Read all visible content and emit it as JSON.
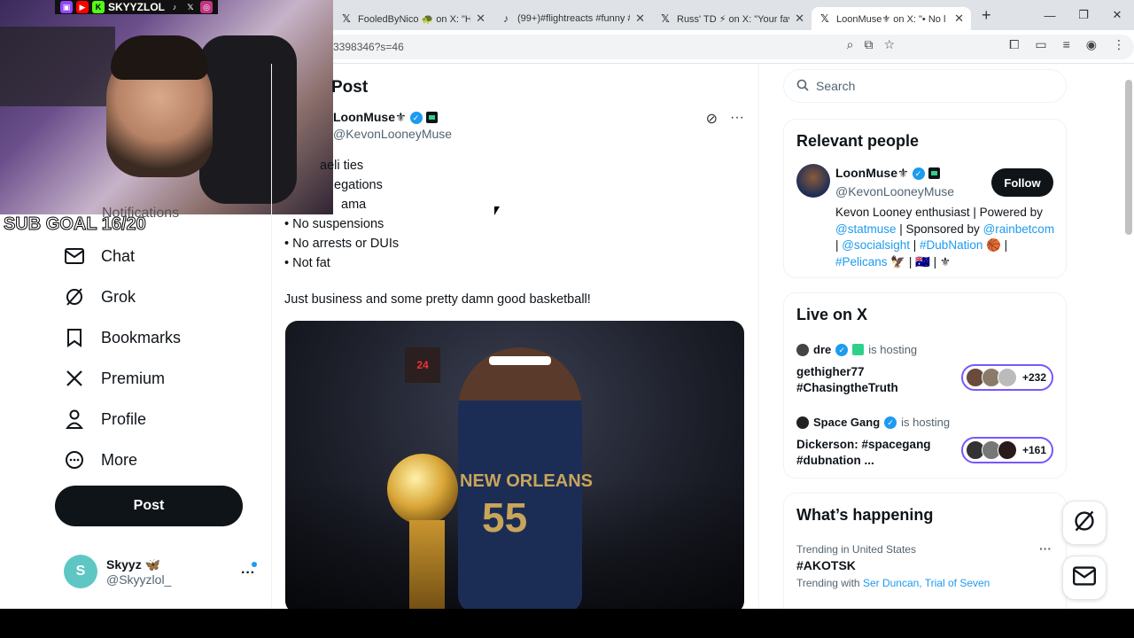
{
  "browser": {
    "tabs": [
      {
        "title": "FooledByNico 🐢 on X: \"He",
        "icon": "x-icon",
        "active": false
      },
      {
        "title": "(99+)#flightreacts #funny #",
        "icon": "tiktok-icon",
        "active": false
      },
      {
        "title": "Russ' TD ⚡ on X: \"Your fav",
        "icon": "x-icon",
        "active": false
      },
      {
        "title": "LoonMuse⚜ on X: \"• No l",
        "icon": "x-icon",
        "active": true
      }
    ],
    "url": "3398346?s=46"
  },
  "stream": {
    "username": "SKYYZLOL",
    "sub_goal": "SUB GOAL 16/20",
    "colors": {
      "twitch": "#9146ff",
      "youtube": "#ff0000",
      "kick": "#53fc18"
    }
  },
  "nav": {
    "partial_label": "Notifications",
    "items": [
      {
        "label": "Chat",
        "icon": "mail-icon"
      },
      {
        "label": "Grok",
        "icon": "grok-icon"
      },
      {
        "label": "Bookmarks",
        "icon": "bookmark-icon"
      },
      {
        "label": "Premium",
        "icon": "x-logo-icon"
      },
      {
        "label": "Profile",
        "icon": "person-icon"
      },
      {
        "label": "More",
        "icon": "more-circle-icon"
      }
    ],
    "post_label": "Post",
    "account": {
      "name": "Skyyz 🦋",
      "handle": "@Skyyzlol_"
    }
  },
  "post": {
    "header": "Post",
    "author_name": "LoonMuse⚜",
    "author_handle": "@KevonLooneyMuse",
    "lines": [
      "• Israeli ties",
      "• Allegations",
      "• Drama",
      "• No suspensions",
      "• No arrests or DUIs",
      "• Not fat"
    ],
    "visible_lines": [
      "aeli ties",
      "egations",
      "ama",
      "• No suspensions",
      "• No arrests or DUIs",
      "• Not fat"
    ],
    "body": "Just business and some pretty damn good basketball!",
    "image": {
      "jersey": "NEW ORLEANS",
      "number": "55",
      "scoreboard": "24"
    }
  },
  "sidebar": {
    "search_placeholder": "Search",
    "relevant": {
      "title": "Relevant people",
      "name": "LoonMuse⚜",
      "handle": "@KevonLooneyMuse",
      "follow": "Follow",
      "bio_1": "Kevon Looney enthusiast | Powered by",
      "bio_link_1": "@statmuse",
      "bio_2": " | Sponsored by",
      "bio_link_2": "@rainbetcom",
      "bio_sep": " | ",
      "bio_link_3": "@socialsight",
      "bio_sep2": " |",
      "bio_link_4": "#DubNation",
      "bio_mid": " 🏀 | ",
      "bio_link_5": "#Pelicans",
      "bio_tail": " 🦅 | 🇦🇺 | ⚜"
    },
    "live": {
      "title": "Live on X",
      "hosting_label": "is hosting",
      "spaces": [
        {
          "host": "dre",
          "title": "gethigher77 #ChasingtheTruth",
          "count": "+232"
        },
        {
          "host": "Space Gang",
          "title": "Dickerson: #spacegang #dubnation ...",
          "count": "+161"
        }
      ]
    },
    "happening": {
      "title": "What’s happening",
      "meta": "Trending in United States",
      "name": "#AKOTSK",
      "with_label": "Trending with",
      "with_links": "Ser Duncan, Trial of Seven"
    }
  }
}
